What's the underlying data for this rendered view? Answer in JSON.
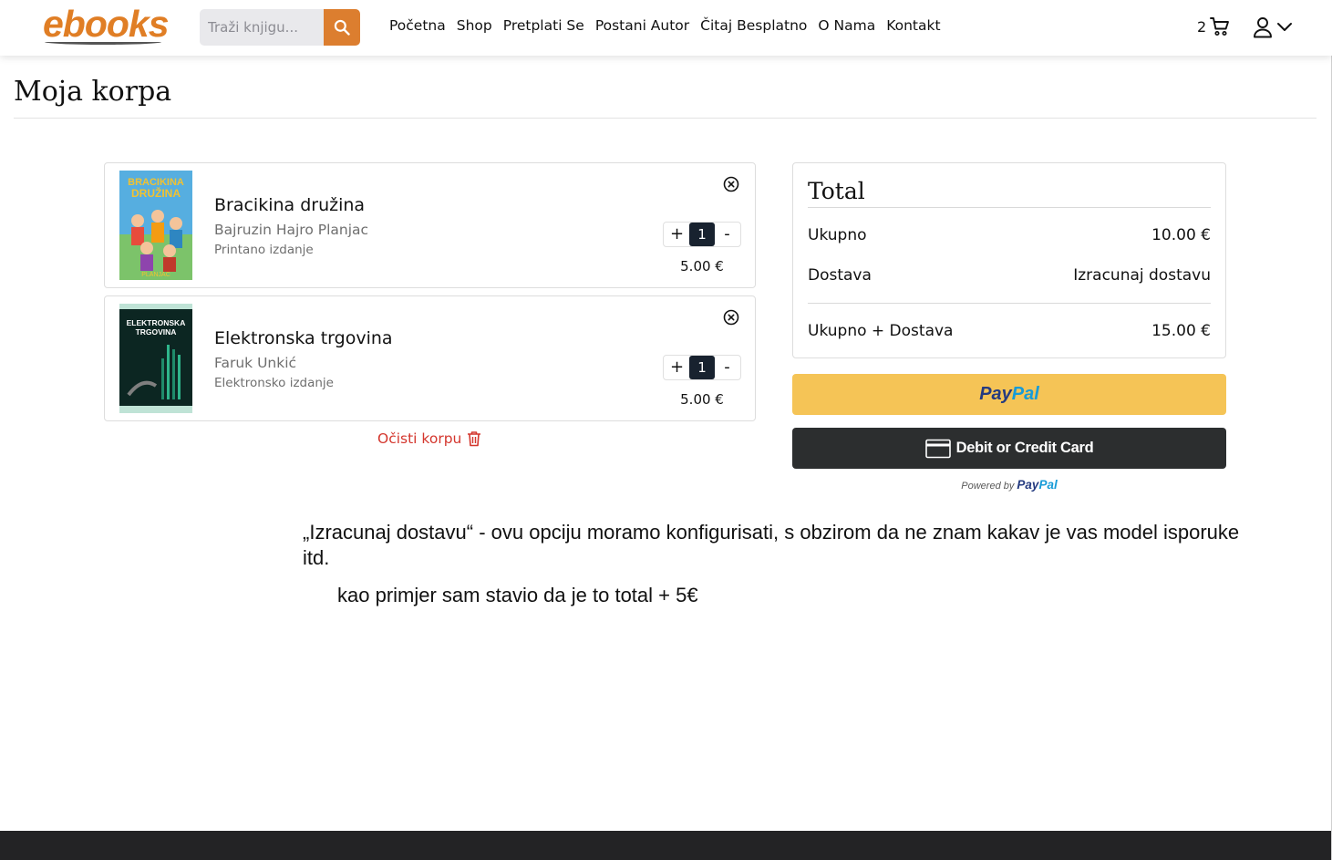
{
  "header": {
    "logo_text": "ebooks",
    "search_placeholder": "Traži knjigu...",
    "nav": [
      "Početna",
      "Shop",
      "Pretplati Se",
      "Postani Autor",
      "Čitaj Besplatno",
      "O Nama",
      "Kontakt"
    ],
    "cart_count": "2"
  },
  "page": {
    "title": "Moja korpa"
  },
  "cart": {
    "items": [
      {
        "title": "Bracikina družina",
        "author": "Bajruzin Hajro Planjac",
        "edition": "Printano izdanje",
        "quantity": "1",
        "price": "5.00 €",
        "cover_colors": [
          "#4aa3d8",
          "#f2c230"
        ]
      },
      {
        "title": "Elektronska trgovina",
        "author": "Faruk Unkić",
        "edition": "Elektronsko izdanje",
        "quantity": "1",
        "price": "5.00 €",
        "cover_colors": [
          "#0d2a24",
          "#3fbf9a"
        ]
      }
    ],
    "plus_label": "+",
    "minus_label": "-",
    "clear_label": "Očisti korpu"
  },
  "summary": {
    "title": "Total",
    "subtotal_label": "Ukupno",
    "subtotal_value": "10.00 €",
    "shipping_label": "Dostava",
    "shipping_value": "Izracunaj dostavu",
    "grand_label": "Ukupno + Dostava",
    "grand_value": "15.00 €"
  },
  "payment": {
    "paypal_a": "Pay",
    "paypal_b": "Pal",
    "card_label": "Debit or Credit Card",
    "powered_by": "Powered by",
    "powered_brand_a": "Pay",
    "powered_brand_b": "Pal"
  },
  "notes": {
    "line1": "„Izracunaj dostavu“ - ovu opciju moramo konfigurisati, s obzirom da ne znam kakav je vas model isporuke itd.",
    "line2": "kao primjer sam stavio da je to total + 5€"
  },
  "colors": {
    "accent": "#dc7e2f",
    "danger": "#d4362d",
    "paypal_yellow": "#f5c456",
    "card_dark": "#2c2e2f"
  }
}
